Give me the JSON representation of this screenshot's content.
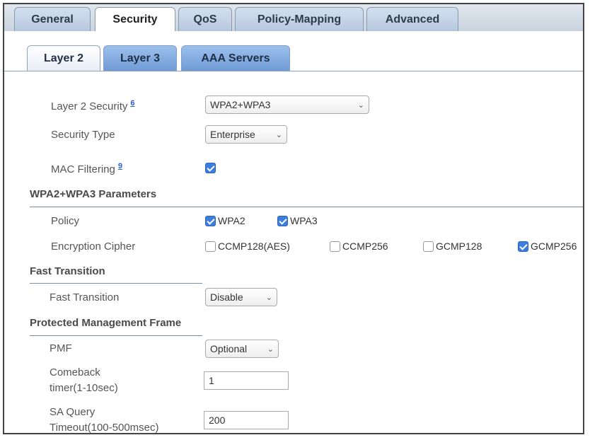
{
  "tabs": {
    "general": "General",
    "security": "Security",
    "qos": "QoS",
    "policy_mapping": "Policy-Mapping",
    "advanced": "Advanced"
  },
  "subtabs": {
    "layer2": "Layer 2",
    "layer3": "Layer 3",
    "aaa": "AAA Servers"
  },
  "layer2": {
    "security_label": "Layer 2 Security",
    "security_help": "6",
    "security_value": "WPA2+WPA3",
    "security_type_label": "Security Type",
    "security_type_value": "Enterprise",
    "mac_filtering_label": "MAC Filtering",
    "mac_filtering_help": "9",
    "mac_filtering_checked": true
  },
  "wpa": {
    "section_title": "WPA2+WPA3 Parameters",
    "policy_label": "Policy",
    "wpa2": "WPA2",
    "wpa3": "WPA3",
    "cipher_label": "Encryption Cipher",
    "ccmp128": "CCMP128(AES)",
    "ccmp256": "CCMP256",
    "gcmp128": "GCMP128",
    "gcmp256": "GCMP256"
  },
  "fast_transition": {
    "section_title": "Fast Transition",
    "label": "Fast Transition",
    "value": "Disable"
  },
  "pmf": {
    "section_title": "Protected Management Frame",
    "label": "PMF",
    "value": "Optional",
    "comeback_label_1": "Comeback",
    "comeback_label_2": "timer(1-10sec)",
    "comeback_value": "1",
    "sa_label_1": "SA Query",
    "sa_label_2": "Timeout(100-500msec)",
    "sa_value": "200"
  }
}
